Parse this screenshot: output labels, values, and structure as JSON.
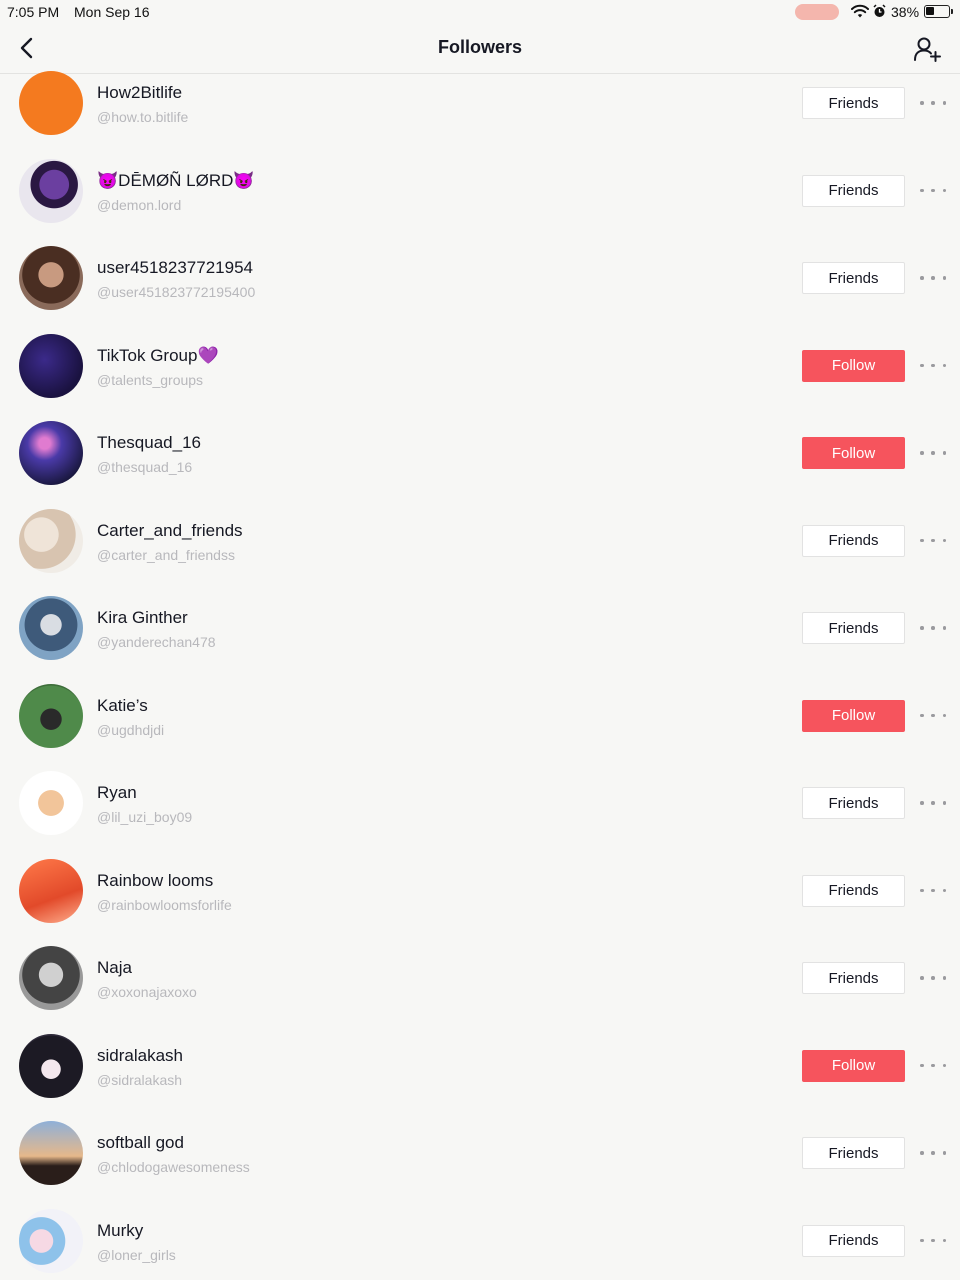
{
  "status_bar": {
    "time": "7:05 PM",
    "date": "Mon Sep 16",
    "battery_percent": "38%",
    "battery_level": 0.38,
    "icons": [
      "wifi-icon",
      "alarm-icon",
      "battery-icon"
    ]
  },
  "header": {
    "title": "Followers",
    "back_icon": "chevron-left-icon",
    "action_icon": "add-user-icon"
  },
  "colors": {
    "background": "#f7f7f5",
    "follow_button": "#f6545d",
    "handle_text": "#b8b8bc",
    "name_text": "#161823"
  },
  "followers": [
    {
      "name": "How2Bitlife",
      "handle": "@how.to.bitlife",
      "button": "Friends",
      "state": "friends",
      "avatar": "bitlife-logo"
    },
    {
      "name": "😈DĒMØÑ LØRD😈",
      "handle": "@demon.lord",
      "button": "Friends",
      "state": "friends",
      "avatar": "anime-character"
    },
    {
      "name": "user4518237721954",
      "handle": "@user451823772195400",
      "button": "Friends",
      "state": "friends",
      "avatar": "girl-photo"
    },
    {
      "name": "TikTok Group💜",
      "handle": "@talents_groups",
      "button": "Follow",
      "state": "follow",
      "avatar": "we-are-one-text"
    },
    {
      "name": "Thesquad_16",
      "handle": "@thesquad_16",
      "button": "Follow",
      "state": "follow",
      "avatar": "galaxy"
    },
    {
      "name": "Carter_and_friends",
      "handle": "@carter_and_friendss",
      "button": "Friends",
      "state": "friends",
      "avatar": "family-photo"
    },
    {
      "name": "Kira Ginther",
      "handle": "@yanderechan478",
      "button": "Friends",
      "state": "friends",
      "avatar": "selfie"
    },
    {
      "name": "Katie’s",
      "handle": "@ugdhdjdi",
      "button": "Follow",
      "state": "follow",
      "avatar": "dog-on-grass"
    },
    {
      "name": "Ryan",
      "handle": "@lil_uzi_boy09",
      "button": "Friends",
      "state": "friends",
      "avatar": "bitmoji"
    },
    {
      "name": "Rainbow looms",
      "handle": "@rainbowloomsforlife",
      "button": "Friends",
      "state": "friends",
      "avatar": "orange-loom"
    },
    {
      "name": "Naja",
      "handle": "@xoxonajaxoxo",
      "button": "Friends",
      "state": "friends",
      "avatar": "bw-selfie"
    },
    {
      "name": "sidralakash",
      "handle": "@sidralakash",
      "button": "Follow",
      "state": "follow",
      "avatar": "anime-girl"
    },
    {
      "name": "softball god",
      "handle": "@chlodogawesomeness",
      "button": "Friends",
      "state": "friends",
      "avatar": "sunset-silhouette"
    },
    {
      "name": "Murky",
      "handle": "@loner_girls",
      "button": "Friends",
      "state": "friends",
      "avatar": "chibi-characters"
    }
  ]
}
